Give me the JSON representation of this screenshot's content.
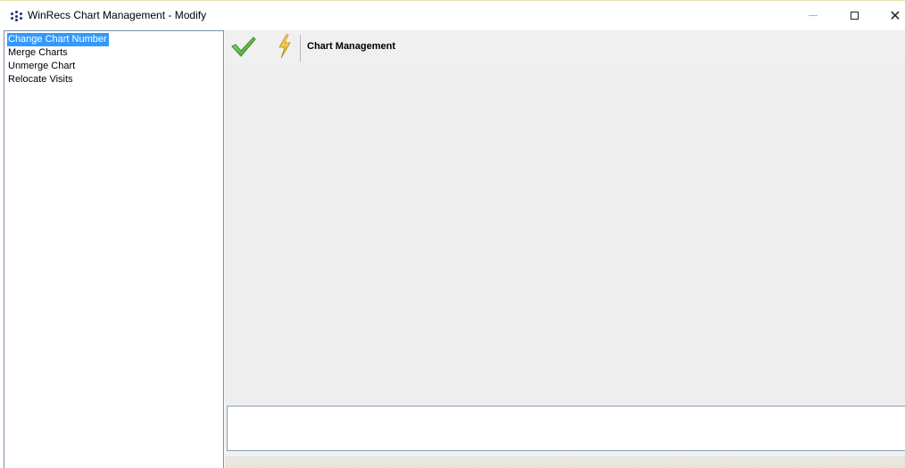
{
  "window": {
    "title": "WinRecs Chart Management - Modify",
    "icon": "winrecs-app-icon",
    "controls": {
      "minimize_icon": "minimize-icon",
      "maximize_icon": "maximize-icon",
      "close_glyph": "✕"
    }
  },
  "sidebar": {
    "items": [
      {
        "label": "Change Chart Number",
        "selected": true
      },
      {
        "label": "Merge Charts",
        "selected": false
      },
      {
        "label": "Unmerge Chart",
        "selected": false
      },
      {
        "label": "Relocate Visits",
        "selected": false
      }
    ]
  },
  "toolbar": {
    "accept_icon": "check-icon",
    "action_icon": "lightning-bolt-icon",
    "title": "Chart Management"
  },
  "message_box": {
    "value": ""
  },
  "colors": {
    "selection": "#3399ff",
    "panel_background": "#f0f0f0",
    "list_border": "#7a8ea8",
    "check_green": "#5bb53a",
    "bolt_yellow": "#f2c230"
  }
}
